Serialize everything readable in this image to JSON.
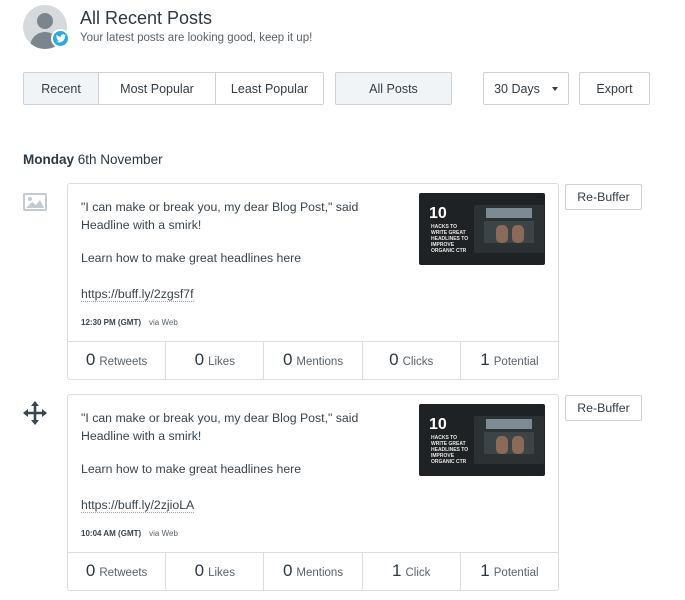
{
  "header": {
    "title": "All Recent Posts",
    "subtitle": "Your latest posts are looking good, keep it up!",
    "avatar_icon": "user-avatar-icon",
    "badge_icon": "twitter-icon"
  },
  "filters": {
    "tabs": [
      "Recent",
      "Most Popular",
      "Least Popular"
    ],
    "selected_tab": "Recent",
    "all_posts": "All Posts",
    "range_select": "30 Days",
    "export": "Export"
  },
  "day": {
    "weekday": "Monday",
    "date": "6th November"
  },
  "posts": [
    {
      "text": "\"I can make or break you, my dear Blog Post,\" said Headline with a smirk!",
      "learn": "Learn how to make great headlines here",
      "link": "https://buff.ly/2zgsf7f",
      "time": "12:30 PM (GMT)",
      "via": "via Web",
      "side_icon": "image-icon",
      "thumb": {
        "num": "10",
        "caption": "HACKS TO WRITE GREAT HEADLINES TO IMPROVE ORGANIC CTR"
      },
      "rebuffer": "Re-Buffer",
      "stats": [
        {
          "n": "0",
          "l": "Retweets"
        },
        {
          "n": "0",
          "l": "Likes"
        },
        {
          "n": "0",
          "l": "Mentions"
        },
        {
          "n": "0",
          "l": "Clicks"
        },
        {
          "n": "1",
          "l": "Potential"
        }
      ]
    },
    {
      "text": "\"I can make or break you, my dear Blog Post,\" said Headline with a smirk!",
      "learn": "Learn how to make great headlines here",
      "link": "https://buff.ly/2zjioLA",
      "time": "10:04 AM (GMT)",
      "via": "via Web",
      "side_icon": "move-arrows-icon",
      "thumb": {
        "num": "10",
        "caption": "HACKS TO WRITE GREAT HEADLINES TO IMPROVE ORGANIC CTR"
      },
      "rebuffer": "Re-Buffer",
      "stats": [
        {
          "n": "0",
          "l": "Retweets"
        },
        {
          "n": "0",
          "l": "Likes"
        },
        {
          "n": "0",
          "l": "Mentions"
        },
        {
          "n": "1",
          "l": "Click"
        },
        {
          "n": "1",
          "l": "Potential"
        }
      ]
    }
  ],
  "colors": {
    "border": "#ccd2d6",
    "active_bg": "#f1f4f6",
    "twitter": "#2da9e1",
    "text": "#323b43"
  }
}
